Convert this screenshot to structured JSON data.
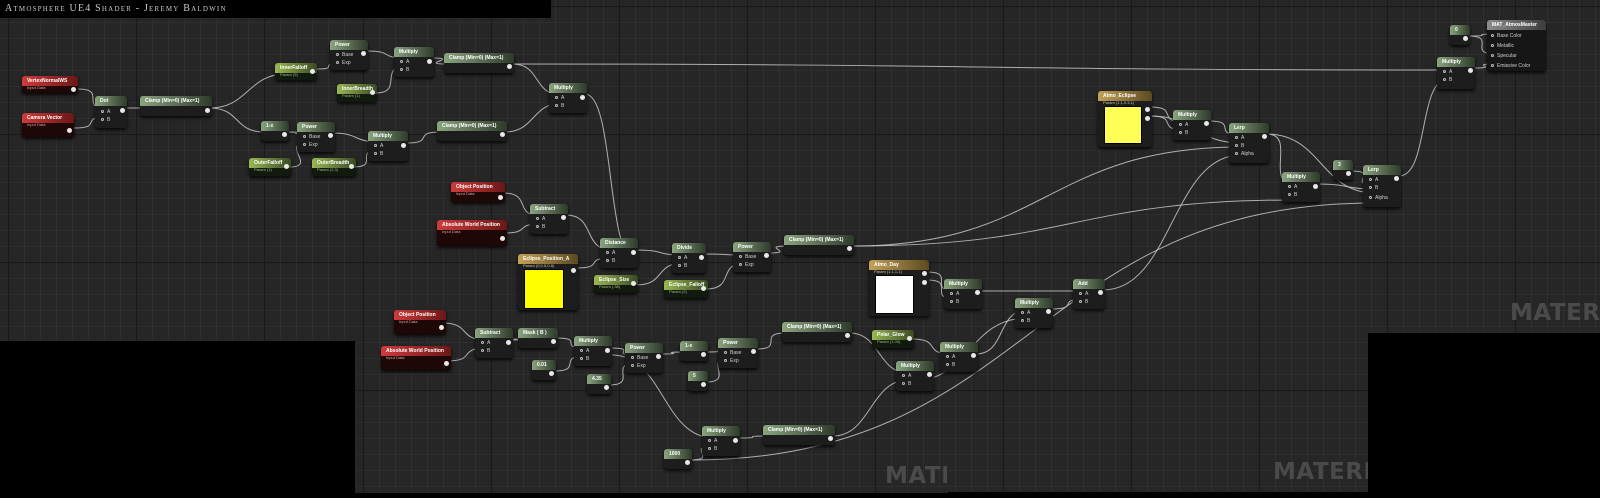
{
  "title": "Atmosphere UE4 Shader - Jeremy Baldwin",
  "watermark": "MATERIAL",
  "colors": {
    "canvas": "#262626",
    "wire": "#c8c8c8",
    "swatch_yellow": "#ffff00",
    "swatch_pale_yellow": "#ffff55",
    "swatch_white": "#ffffff"
  },
  "nodes": {
    "vertex_normal": {
      "title": "VertexNormalWS",
      "sub": "Input Data"
    },
    "camera_vector": {
      "title": "Camera Vector",
      "sub": "Input Data"
    },
    "dot": {
      "title": "Dot",
      "a": "A",
      "b": "B"
    },
    "clamp1": {
      "title": "Clamp (Min=0) (Max=1)"
    },
    "inner_falloff": {
      "title": "InnerFalloff",
      "sub": "Param (9)"
    },
    "power1": {
      "title": "Power",
      "base": "Base",
      "exp": "Exp"
    },
    "inner_breadth": {
      "title": "InnerBreadth",
      "sub": "Param (1)"
    },
    "multiply1": {
      "title": "Multiply",
      "a": "A",
      "b": "B"
    },
    "clamp2": {
      "title": "Clamp (Min=0) (Max=1)"
    },
    "multiply_top": {
      "title": "Multiply",
      "a": "A",
      "b": "B"
    },
    "one_minus": {
      "title": "1-x"
    },
    "power2": {
      "title": "Power",
      "base": "Base",
      "exp": "Exp"
    },
    "outer_falloff": {
      "title": "OuterFalloff",
      "sub": "Param (1)"
    },
    "outer_breadth": {
      "title": "OuterBreadth",
      "sub": "Param (2.3)"
    },
    "multiply2": {
      "title": "Multiply",
      "a": "A",
      "b": "B"
    },
    "clamp3": {
      "title": "Clamp (Min=0) (Max=1)"
    },
    "object_position1": {
      "title": "Object Position",
      "sub": "Input Data"
    },
    "abs_world_pos1": {
      "title": "Absolute World Position",
      "sub": "Input Data"
    },
    "subtract1": {
      "title": "Subtract",
      "a": "A",
      "b": "B"
    },
    "eclipse_position": {
      "title": "Eclipse_Position_A",
      "sub": "Param (0,0.5,0.8)"
    },
    "distance": {
      "title": "Distance",
      "a": "A",
      "b": "B"
    },
    "eclipse_size": {
      "title": "Eclipse_Size",
      "sub": "Param (.38)"
    },
    "divide": {
      "title": "Divide",
      "a": "A",
      "b": "B"
    },
    "eclipse_falloff": {
      "title": "Eclipse_Falloff",
      "sub": "Param (2)"
    },
    "power3": {
      "title": "Power",
      "base": "Base",
      "exp": "Exp"
    },
    "clamp4": {
      "title": "Clamp (Min=0) (Max=1)"
    },
    "object_position2": {
      "title": "Object Position",
      "sub": "Input Data"
    },
    "abs_world_pos2": {
      "title": "Absolute World Position",
      "sub": "Input Data"
    },
    "subtract2": {
      "title": "Subtract",
      "a": "A",
      "b": "B"
    },
    "mask": {
      "title": "Mask ( B )"
    },
    "const_001": {
      "title": "0.01"
    },
    "multiply3": {
      "title": "Multiply",
      "a": "A",
      "b": "B"
    },
    "const_435": {
      "title": "4.35"
    },
    "power4": {
      "title": "Power",
      "base": "Base",
      "exp": "Exp"
    },
    "one_minus2": {
      "title": "1-x"
    },
    "power5": {
      "title": "Power",
      "base": "Base",
      "exp": "Exp"
    },
    "const_5": {
      "title": "5"
    },
    "clamp5": {
      "title": "Clamp (Min=0) (Max=1)"
    },
    "polar_glow": {
      "title": "Polar_Glow",
      "sub": "Param (1.09)"
    },
    "multiply4": {
      "title": "Multiply",
      "a": "A",
      "b": "B"
    },
    "multiply5": {
      "title": "Multiply",
      "a": "A",
      "b": "B"
    },
    "atmo_day": {
      "title": "Atmo_Day",
      "sub": "Param (1,1,1,1)"
    },
    "multiply6": {
      "title": "Multiply",
      "a": "A",
      "b": "B"
    },
    "multiply7": {
      "title": "Multiply",
      "a": "A",
      "b": "B"
    },
    "add": {
      "title": "Add",
      "a": "A",
      "b": "B"
    },
    "const_1000": {
      "title": "1000"
    },
    "multiply8": {
      "title": "Multiply",
      "a": "A",
      "b": "B"
    },
    "clamp6": {
      "title": "Clamp (Min=0) (Max=1)"
    },
    "atmo_eclipse": {
      "title": "Atmo_Eclipse",
      "sub": "Param (1,1,0.3,1)"
    },
    "multiply9": {
      "title": "Multiply",
      "a": "A",
      "b": "B"
    },
    "lerp1": {
      "title": "Lerp",
      "a": "A",
      "b": "B",
      "alpha": "Alpha"
    },
    "multiply10": {
      "title": "Multiply",
      "a": "A",
      "b": "B"
    },
    "const_3": {
      "title": "3"
    },
    "lerp2": {
      "title": "Lerp",
      "a": "A",
      "b": "B",
      "alpha": "Alpha"
    },
    "const_0": {
      "title": "0"
    },
    "multiply11": {
      "title": "Multiply",
      "a": "A",
      "b": "B"
    },
    "result": {
      "title": "MAT_AtmosMaster",
      "pins": [
        "Base Color",
        "Metallic",
        "Specular",
        "Emissive Color"
      ]
    }
  }
}
